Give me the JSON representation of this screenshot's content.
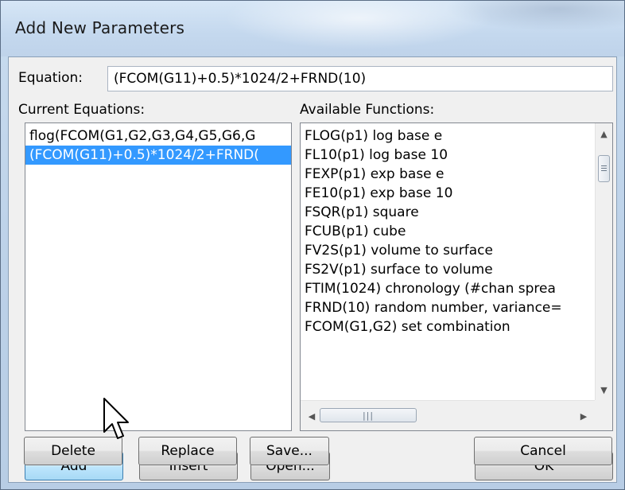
{
  "window": {
    "title": "Add New Parameters"
  },
  "equation": {
    "label": "Equation:",
    "value": "(FCOM(G11)+0.5)*1024/2+FRND(10)"
  },
  "current_equations": {
    "label": "Current Equations:",
    "items": [
      {
        "text": "flog(FCOM(G1,G2,G3,G4,G5,G6,G",
        "selected": false
      },
      {
        "text": "(FCOM(G11)+0.5)*1024/2+FRND(",
        "selected": true
      }
    ]
  },
  "available_functions": {
    "label": "Available Functions:",
    "items": [
      "FLOG(p1) log base e",
      "FL10(p1) log base 10",
      "FEXP(p1) exp base e",
      "FE10(p1) exp base 10",
      "FSQR(p1) square",
      "FCUB(p1) cube",
      "FV2S(p1) volume to surface",
      "FS2V(p1) surface to volume",
      "FTIM(1024) chronology (#chan sprea",
      "FRND(10) random number, variance=",
      "FCOM(G1,G2) set combination"
    ],
    "vscroll_icons": {
      "up": "scroll-up-arrow-icon",
      "down": "scroll-down-arrow-icon"
    },
    "hscroll_icons": {
      "left": "scroll-left-arrow-icon",
      "right": "scroll-right-arrow-icon"
    }
  },
  "buttons": {
    "add": "Add",
    "insert": "Insert",
    "open": "Open...",
    "ok": "OK",
    "delete": "Delete",
    "replace": "Replace",
    "save": "Save...",
    "cancel": "Cancel"
  },
  "colors": {
    "selection": "#3399ff",
    "hot_button": "#bee6fd",
    "dialog_face": "#f0f0f0"
  }
}
